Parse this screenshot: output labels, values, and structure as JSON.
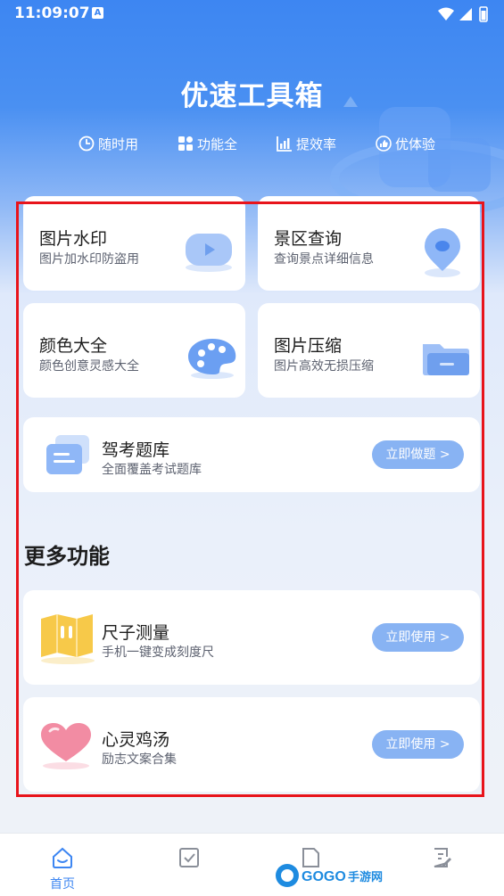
{
  "status": {
    "time": "11:09:07",
    "badge": "A"
  },
  "hero": {
    "title": "优速工具箱",
    "features": [
      {
        "label": "随时用",
        "icon": "clock-sync-icon"
      },
      {
        "label": "功能全",
        "icon": "grid-icon"
      },
      {
        "label": "提效率",
        "icon": "bar-chart-icon"
      },
      {
        "label": "优体验",
        "icon": "thumbs-up-icon"
      }
    ]
  },
  "tools": [
    {
      "title": "图片水印",
      "subtitle": "图片加水印防盗用",
      "icon": "video-play-icon"
    },
    {
      "title": "景区查询",
      "subtitle": "查询景点详细信息",
      "icon": "location-pin-icon"
    },
    {
      "title": "颜色大全",
      "subtitle": "颜色创意灵感大全",
      "icon": "palette-icon"
    },
    {
      "title": "图片压缩",
      "subtitle": "图片高效无损压缩",
      "icon": "folder-icon"
    }
  ],
  "exam": {
    "title": "驾考题库",
    "subtitle": "全面覆盖考试题库",
    "button": "立即做题 >",
    "icon": "document-stack-icon"
  },
  "more": {
    "title": "更多功能",
    "items": [
      {
        "title": "尺子测量",
        "subtitle": "手机一键变成刻度尺",
        "button": "立即使用 >",
        "icon": "ruler-icon"
      },
      {
        "title": "心灵鸡汤",
        "subtitle": "励志文案合集",
        "button": "立即使用 >",
        "icon": "heart-icon"
      }
    ]
  },
  "tabs": [
    {
      "label": "首页",
      "icon": "home-icon",
      "active": true
    },
    {
      "label": "",
      "icon": "checkbox-icon",
      "active": false
    },
    {
      "label": "",
      "icon": "document-icon",
      "active": false
    },
    {
      "label": "",
      "icon": "edit-icon",
      "active": false
    }
  ],
  "watermark": "GOGO手游网",
  "colors": {
    "accent": "#3d86f2",
    "button": "#88b3f3",
    "highlight_frame": "#e8141b"
  }
}
